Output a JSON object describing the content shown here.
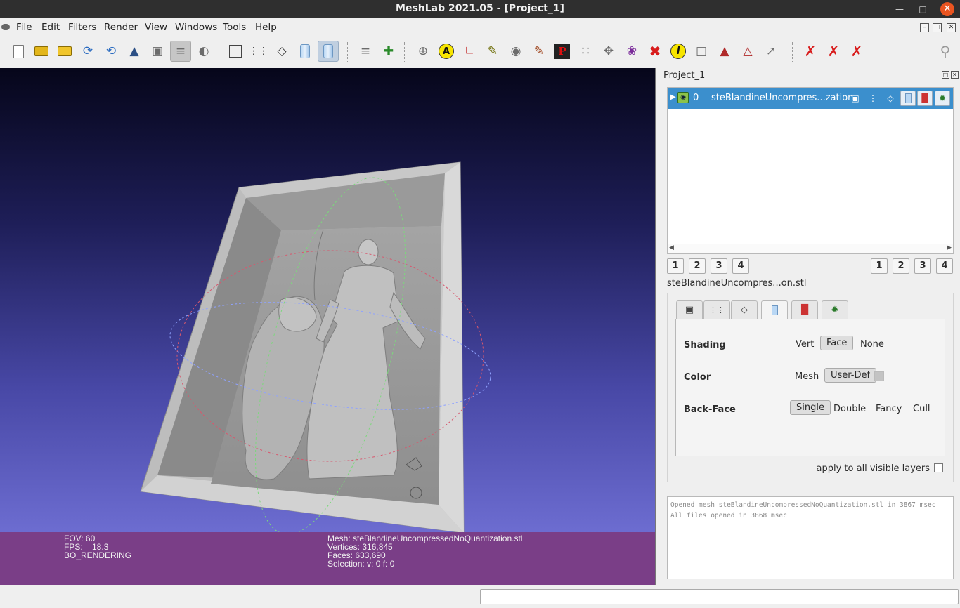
{
  "window": {
    "title": "MeshLab 2021.05 - [Project_1]"
  },
  "menu": [
    "File",
    "Edit",
    "Filters",
    "Render",
    "View",
    "Windows",
    "Tools",
    "Help"
  ],
  "toolbar": {
    "icons": [
      "new-project",
      "open-project",
      "import-mesh",
      "reload",
      "reload-all",
      "export-mesh",
      "snapshot",
      "layer-toggle",
      "sphere-toggle",
      "bbox",
      "points",
      "wireframe",
      "flat",
      "smooth",
      "raster-layers",
      "axes",
      "trackball",
      "annotate",
      "measure",
      "info-tool",
      "camera",
      "paint",
      "paint-point",
      "select-vertices",
      "select-faces",
      "paint-brush",
      "georef",
      "info",
      "select-rect",
      "select-region",
      "select-conn",
      "select-edit",
      "delete-vertices",
      "delete-faces",
      "delete-selected",
      "search"
    ],
    "badges": {
      "annotate": "A",
      "info": "i",
      "pp": "P"
    }
  },
  "project": {
    "title": "Project_1",
    "layer": {
      "index": "0",
      "name": "steBlandineUncompres...zation"
    },
    "left_buttons": [
      "1",
      "2",
      "3",
      "4"
    ],
    "right_buttons": [
      "1",
      "2",
      "3",
      "4"
    ],
    "file_label": "steBlandineUncompres...on.stl"
  },
  "render_panel": {
    "active_tab": "fill",
    "shading": {
      "label": "Shading",
      "options": [
        "Vert",
        "Face",
        "None"
      ],
      "selected": "Face"
    },
    "color": {
      "label": "Color",
      "options": [
        "Mesh",
        "User-Def"
      ],
      "selected": "User-Def",
      "swatch": "#c3c3c3"
    },
    "backface": {
      "label": "Back-Face",
      "options": [
        "Single",
        "Double",
        "Fancy",
        "Cull"
      ],
      "selected": "Single"
    },
    "apply_all": "apply to all visible layers"
  },
  "log": [
    "Opened mesh steBlandineUncompressedNoQuantization.stl in 3867 msec",
    "All files opened in 3868 msec"
  ],
  "viewport_info": {
    "left": [
      "FOV: 60",
      "FPS:    18.3",
      "BO_RENDERING"
    ],
    "right": [
      "Mesh: steBlandineUncompressedNoQuantization.stl",
      "Vertices: 316,845",
      "Faces: 633,690",
      "Selection: v: 0 f: 0"
    ]
  },
  "colors": {
    "info_bar": "#7a3e87",
    "selection": "#3b8fcd",
    "close_button": "#e95420"
  }
}
